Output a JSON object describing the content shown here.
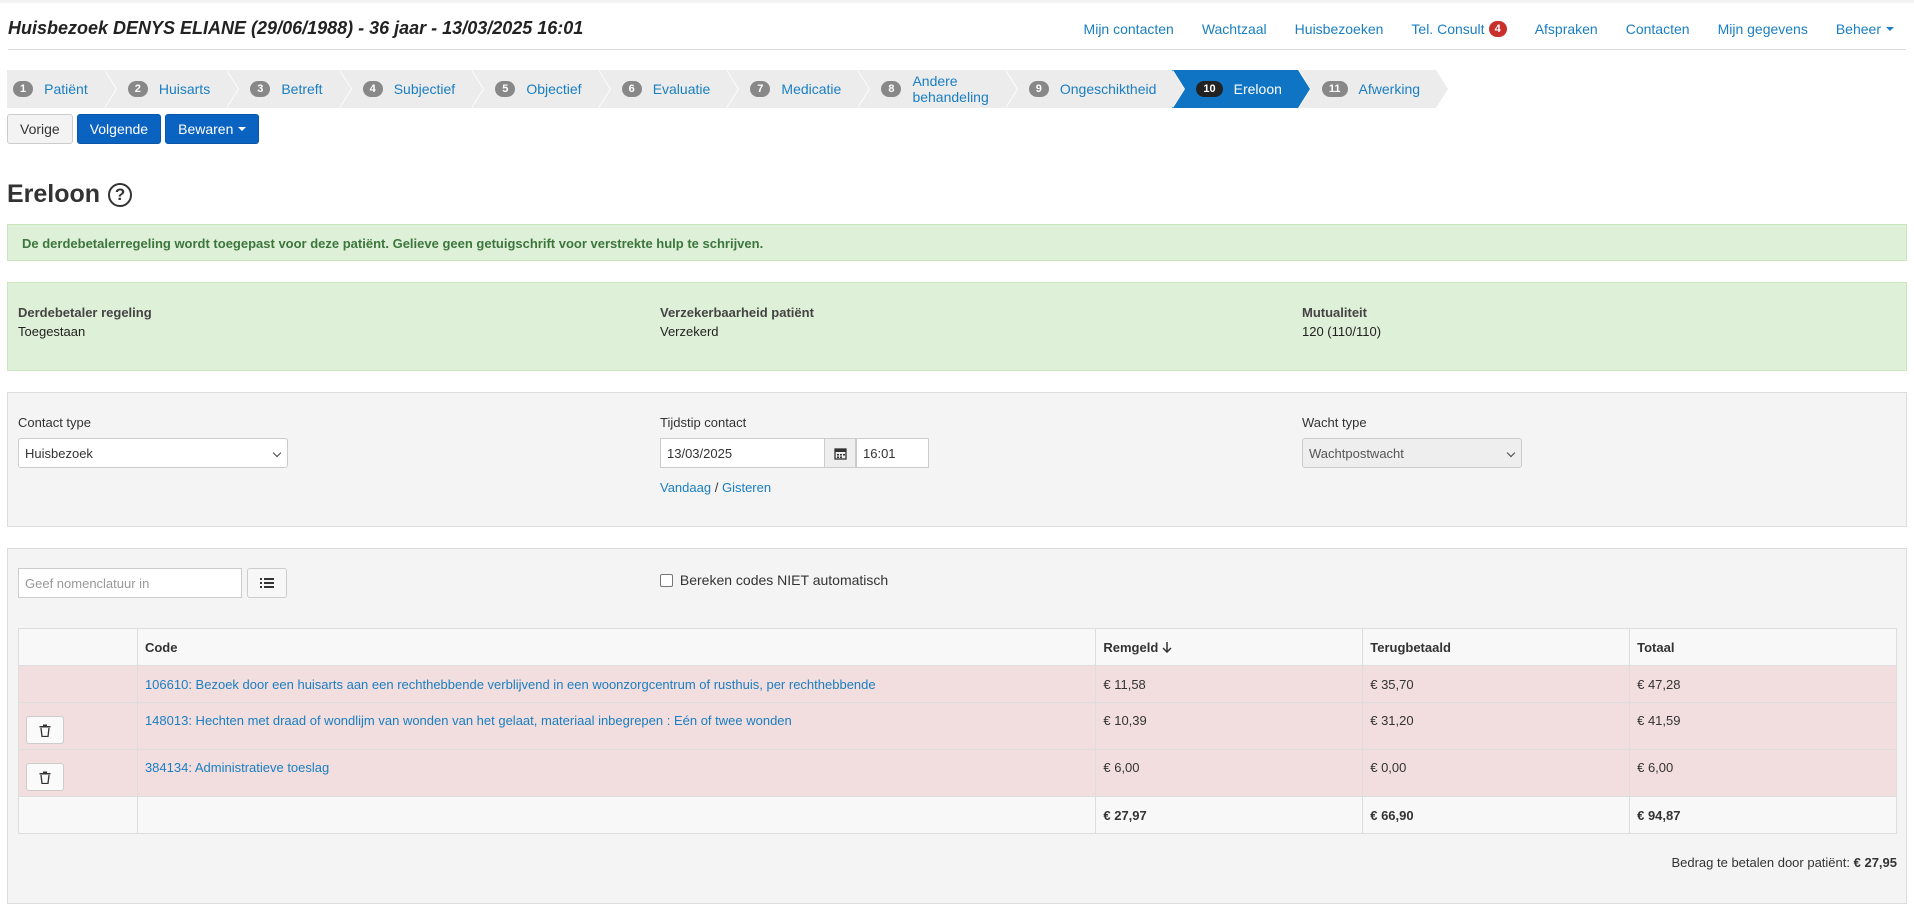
{
  "header": {
    "title": "Huisbezoek DENYS ELIANE (29/06/1988) - 36 jaar - 13/03/2025 16:01",
    "nav": [
      {
        "label": "Mijn contacten"
      },
      {
        "label": "Wachtzaal"
      },
      {
        "label": "Huisbezoeken"
      },
      {
        "label": "Tel. Consult",
        "badge": "4"
      },
      {
        "label": "Afspraken"
      },
      {
        "label": "Contacten"
      },
      {
        "label": "Mijn gegevens"
      },
      {
        "label": "Beheer",
        "dropdown": true
      }
    ]
  },
  "steps": [
    {
      "num": "1",
      "label": "Patiënt"
    },
    {
      "num": "2",
      "label": "Huisarts"
    },
    {
      "num": "3",
      "label": "Betreft"
    },
    {
      "num": "4",
      "label": "Subjectief"
    },
    {
      "num": "5",
      "label": "Objectief"
    },
    {
      "num": "6",
      "label": "Evaluatie"
    },
    {
      "num": "7",
      "label": "Medicatie"
    },
    {
      "num": "8",
      "label": "Andere behandeling"
    },
    {
      "num": "9",
      "label": "Ongeschiktheid"
    },
    {
      "num": "10",
      "label": "Ereloon",
      "active": true
    },
    {
      "num": "11",
      "label": "Afwerking"
    }
  ],
  "buttons": {
    "prev": "Vorige",
    "next": "Volgende",
    "save": "Bewaren"
  },
  "page_title": "Ereloon",
  "help_icon_glyph": "?",
  "alert": "De derdebetalerregeling wordt toegepast voor deze patiënt. Gelieve geen getuigschrift voor verstrekte hulp te schrijven.",
  "insurance": {
    "third_payer_label": "Derdebetaler regeling",
    "third_payer_value": "Toegestaan",
    "insurability_label": "Verzekerbaarheid patiënt",
    "insurability_value": "Verzekerd",
    "mutuality_label": "Mutualiteit",
    "mutuality_value": "120 (110/110)"
  },
  "contact": {
    "type_label": "Contact type",
    "type_value": "Huisbezoek",
    "time_label": "Tijdstip contact",
    "date_value": "13/03/2025",
    "time_value": "16:01",
    "today_link": "Vandaag",
    "separator": "/",
    "yesterday_link": "Gisteren",
    "watch_label": "Wacht type",
    "watch_value": "Wachtpostwacht"
  },
  "nomenclature": {
    "placeholder": "Geef nomenclatuur in",
    "no_auto_label": "Bereken codes NIET automatisch"
  },
  "table": {
    "headers": {
      "code": "Code",
      "remgeld": "Remgeld",
      "terugbetaald": "Terugbetaald",
      "totaal": "Totaal"
    },
    "rows": [
      {
        "code": "106610: Bezoek door een huisarts aan een rechthebbende verblijvend in een woonzorgcentrum of rusthuis, per rechthebbende",
        "remgeld": "€ 11,58",
        "terugbetaald": "€ 35,70",
        "totaal": "€ 47,28",
        "deletable": false
      },
      {
        "code": "148013: Hechten met draad of wondlijm van wonden van het gelaat, materiaal inbegrepen : Eén of twee wonden",
        "remgeld": "€ 10,39",
        "terugbetaald": "€ 31,20",
        "totaal": "€ 41,59",
        "deletable": true
      },
      {
        "code": "384134: Administratieve toeslag",
        "remgeld": "€ 6,00",
        "terugbetaald": "€ 0,00",
        "totaal": "€ 6,00",
        "deletable": true
      }
    ],
    "totals": {
      "remgeld": "€ 27,97",
      "terugbetaald": "€ 66,90",
      "totaal": "€ 94,87"
    }
  },
  "patient_amount": {
    "label": "Bedrag te betalen door patiënt:",
    "value": "€ 27,95"
  },
  "colors": {
    "primary": "#0b63c1",
    "link": "#1a7ec2",
    "success_bg": "#dff0d8",
    "danger_row": "#f2dede",
    "badge": "#c9302c"
  }
}
